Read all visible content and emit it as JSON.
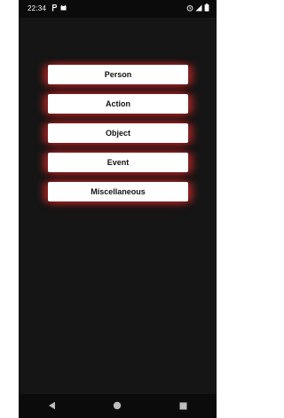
{
  "status_bar": {
    "time": "22:34",
    "left_icons": [
      "parking-icon",
      "cat-icon"
    ],
    "right_icons": [
      "alarm-icon",
      "signal-icon",
      "battery-icon"
    ]
  },
  "menu": {
    "items": [
      {
        "label": "Person"
      },
      {
        "label": "Action"
      },
      {
        "label": "Object"
      },
      {
        "label": "Event"
      },
      {
        "label": "Miscellaneous"
      }
    ]
  },
  "nav_bar": {
    "buttons": [
      "back-icon",
      "home-icon",
      "recents-icon"
    ]
  },
  "colors": {
    "background": "#151515",
    "button": "#ffffff",
    "glow": "#aa2828"
  }
}
